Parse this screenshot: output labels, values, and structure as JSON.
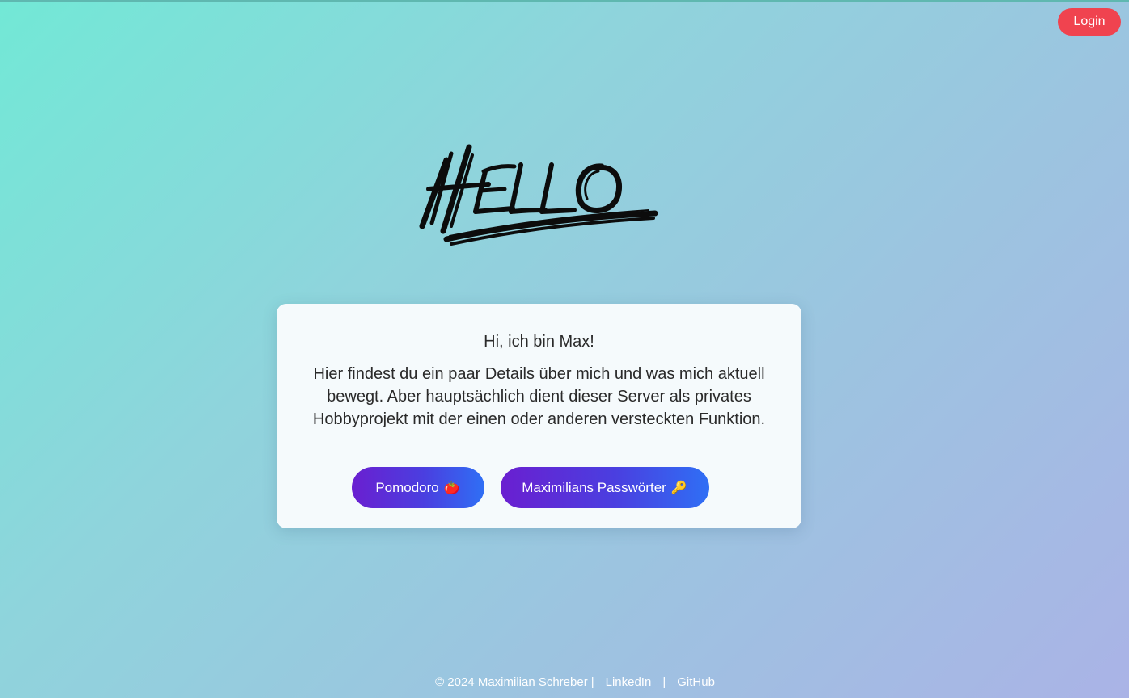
{
  "header": {
    "login_label": "Login"
  },
  "hero": {
    "logo_text": "HELLO"
  },
  "card": {
    "greeting": "Hi, ich bin Max!",
    "intro": "Hier findest du ein paar Details über mich und was mich aktuell bewegt. Aber hauptsächlich dient dieser Server als privates Hobbyprojekt mit der einen oder anderen versteckten Funktion.",
    "buttons": [
      {
        "label": "Pomodoro",
        "icon": "tomato-icon",
        "emoji": "🍅"
      },
      {
        "label": "Maximilians Passwörter",
        "icon": "key-icon",
        "emoji": "🔑"
      }
    ]
  },
  "footer": {
    "copyright": "© 2024 Maximilian Schreber",
    "separator": "|",
    "links": [
      "LinkedIn",
      "GitHub"
    ]
  },
  "colors": {
    "login_bg": "#f0434f",
    "button_gradient_start": "#6a1fd0",
    "button_gradient_end": "#2f6ff5",
    "background_start": "#72e8d6",
    "background_end": "#aab3e6"
  }
}
